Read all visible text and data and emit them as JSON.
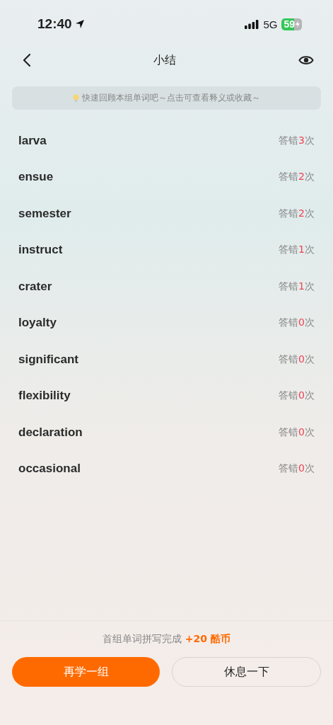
{
  "status_bar": {
    "time": "12:40",
    "network": "5G",
    "battery": "59"
  },
  "nav": {
    "title": "小结"
  },
  "hint": {
    "text": "快速回顾本组单词吧～点击可查看释义或收藏～"
  },
  "words": [
    {
      "word": "larva",
      "errors_prefix": "答错",
      "errors": "3",
      "errors_suffix": "次"
    },
    {
      "word": "ensue",
      "errors_prefix": "答错",
      "errors": "2",
      "errors_suffix": "次"
    },
    {
      "word": "semester",
      "errors_prefix": "答错",
      "errors": "2",
      "errors_suffix": "次"
    },
    {
      "word": "instruct",
      "errors_prefix": "答错",
      "errors": "1",
      "errors_suffix": "次"
    },
    {
      "word": "crater",
      "errors_prefix": "答错",
      "errors": "1",
      "errors_suffix": "次"
    },
    {
      "word": "loyalty",
      "errors_prefix": "答错",
      "errors": "0",
      "errors_suffix": "次"
    },
    {
      "word": "significant",
      "errors_prefix": "答错",
      "errors": "0",
      "errors_suffix": "次"
    },
    {
      "word": "flexibility",
      "errors_prefix": "答错",
      "errors": "0",
      "errors_suffix": "次"
    },
    {
      "word": "declaration",
      "errors_prefix": "答错",
      "errors": "0",
      "errors_suffix": "次"
    },
    {
      "word": "occasional",
      "errors_prefix": "答错",
      "errors": "0",
      "errors_suffix": "次"
    }
  ],
  "footer": {
    "message": "首组单词拼写完成",
    "reward": "+20 酷币",
    "buttons": [
      {
        "label": "再学一组",
        "kind": "primary"
      },
      {
        "label": "休息一下",
        "kind": "secondary"
      }
    ]
  }
}
